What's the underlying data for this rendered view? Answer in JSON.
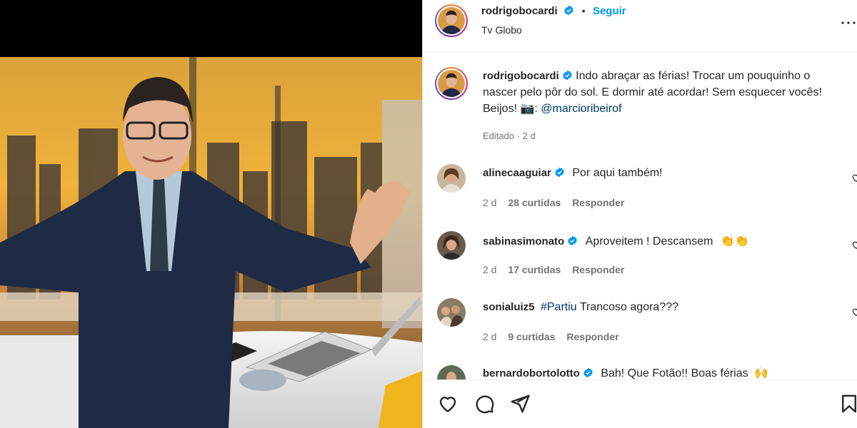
{
  "post": {
    "author": "rodrigobocardi",
    "follow_label": "Seguir",
    "location": "Tv Globo",
    "caption_text": "Indo abraçar as férias! Trocar um pouquinho o nascer pelo pôr do sol. E dormir até acordar! Sem esquecer vocês! Beijos! 📷:",
    "caption_mention": "@marcioribeirof",
    "edited_label": "Editado · 2 d"
  },
  "comments": [
    {
      "user": "alinecaaguiar",
      "verified": true,
      "text": "Por aqui também!",
      "age": "2 d",
      "likes": "28 curtidas",
      "reply": "Responder"
    },
    {
      "user": "sabinasimonato",
      "verified": true,
      "text": "Aproveitem ! Descansem",
      "emoji": "👏👏",
      "age": "2 d",
      "likes": "17 curtidas",
      "reply": "Responder"
    },
    {
      "user": "sonialuiz5",
      "verified": false,
      "hashtag": "#Partiu",
      "text": "Trancoso agora???",
      "age": "2 d",
      "likes": "9 curtidas",
      "reply": "Responder"
    },
    {
      "user": "bernardobortolotto",
      "verified": true,
      "text": "Bah! Que Fotão!! Boas férias",
      "emoji": "🙌",
      "age": "",
      "likes": "",
      "reply": ""
    }
  ],
  "icons": [
    "verified-badge-icon",
    "more-options-icon",
    "heart-icon",
    "comment-icon",
    "share-icon",
    "bookmark-icon"
  ],
  "colors": {
    "verified": "#0095f6",
    "link": "#00376b",
    "follow": "#0095f6",
    "meta": "#737373"
  }
}
